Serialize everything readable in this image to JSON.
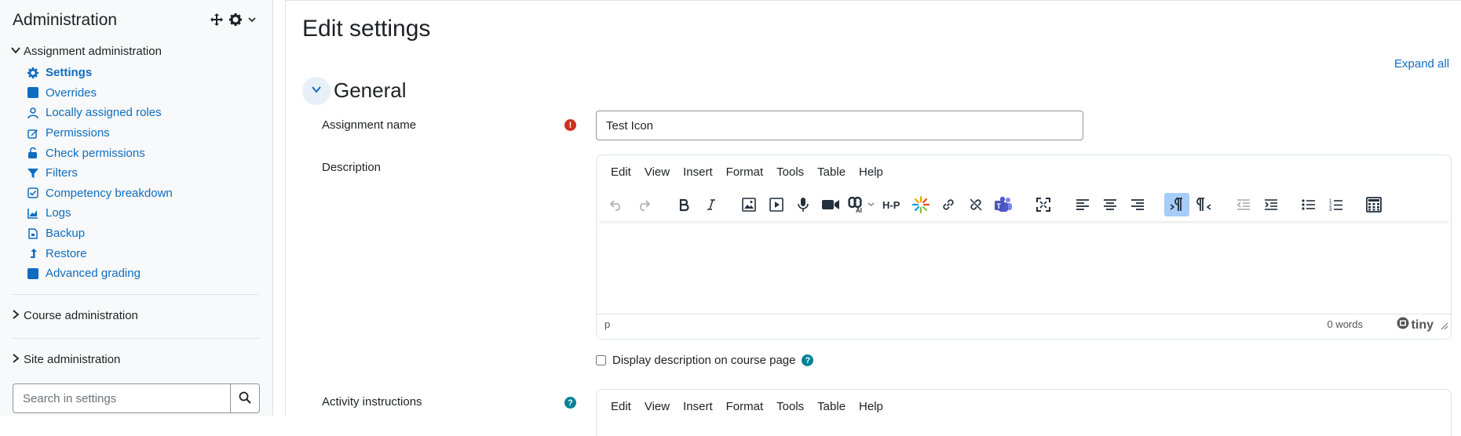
{
  "sidebar": {
    "title": "Administration",
    "assignment_admin": "Assignment administration",
    "items": [
      {
        "label": "Settings",
        "icon": "gear-icon"
      },
      {
        "label": "Overrides",
        "icon": "square-icon"
      },
      {
        "label": "Locally assigned roles",
        "icon": "user-icon"
      },
      {
        "label": "Permissions",
        "icon": "edit-icon"
      },
      {
        "label": "Check permissions",
        "icon": "unlock-icon"
      },
      {
        "label": "Filters",
        "icon": "filter-icon"
      },
      {
        "label": "Competency breakdown",
        "icon": "checkbox-icon"
      },
      {
        "label": "Logs",
        "icon": "chart-icon"
      },
      {
        "label": "Backup",
        "icon": "file-icon"
      },
      {
        "label": "Restore",
        "icon": "level-up-icon"
      },
      {
        "label": "Advanced grading",
        "icon": "square-icon"
      }
    ],
    "course_admin": "Course administration",
    "site_admin": "Site administration",
    "search_placeholder": "Search in settings"
  },
  "main": {
    "title": "Edit settings",
    "expand_all": "Expand all",
    "section_title": "General",
    "assignment_name_label": "Assignment name",
    "assignment_name_value": "Test Icon",
    "description_label": "Description",
    "activity_instructions_label": "Activity instructions",
    "display_description_label": "Display description on course page"
  },
  "editor": {
    "menus": [
      "Edit",
      "View",
      "Insert",
      "Format",
      "Tools",
      "Table",
      "Help"
    ],
    "path": "p",
    "word_count": "0 words",
    "brand": "tiny"
  },
  "colors": {
    "link": "#0f6cbf",
    "required": "#ca3120",
    "help": "#008196",
    "active_tool": "#a6ccf7"
  }
}
